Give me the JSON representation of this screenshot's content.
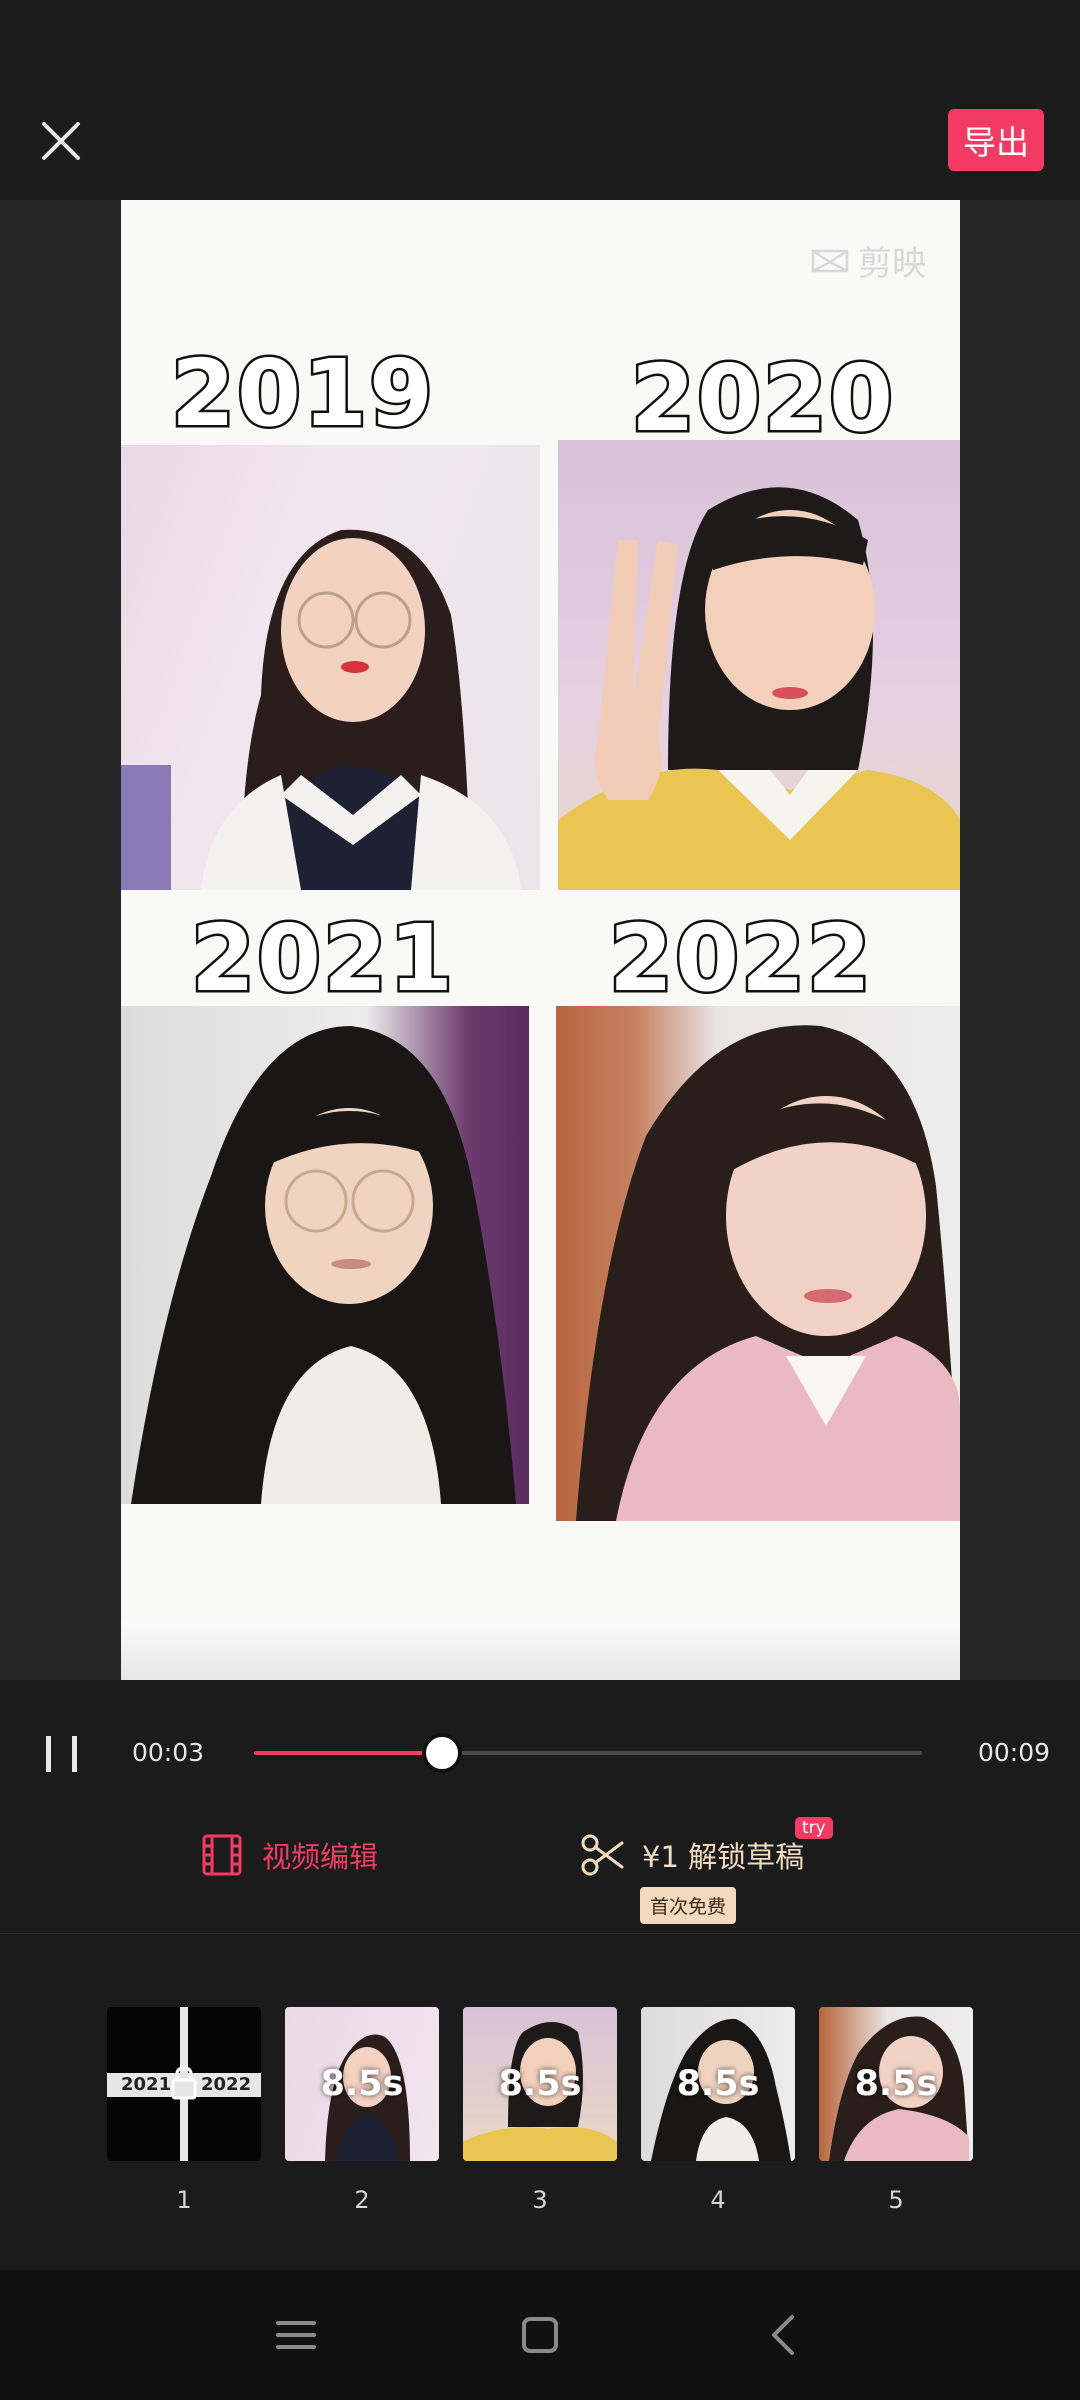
{
  "header": {
    "close_icon": "close-icon",
    "export_label": "导出"
  },
  "preview": {
    "watermark": "剪映",
    "years": [
      "2019",
      "2020",
      "2021",
      "2022"
    ]
  },
  "player": {
    "current_time": "00:03",
    "total_time": "00:09",
    "progress": 0.278,
    "accent": "#f23a62"
  },
  "actions": {
    "edit_label": "视频编辑",
    "unlock_label": "¥1 解锁草稿",
    "try_badge": "try",
    "free_badge": "首次免费"
  },
  "clips": [
    {
      "index": "1",
      "duration": "",
      "thumb": "transition"
    },
    {
      "index": "2",
      "duration": "8.5s",
      "thumb": "photo-2019"
    },
    {
      "index": "3",
      "duration": "8.5s",
      "thumb": "photo-2020"
    },
    {
      "index": "4",
      "duration": "8.5s",
      "thumb": "photo-2021"
    },
    {
      "index": "5",
      "duration": "8.5s",
      "thumb": "photo-2022"
    }
  ],
  "clip1_text": {
    "left": "2021",
    "right": "2022"
  },
  "navbar": {
    "icons": [
      "menu-icon",
      "home-icon",
      "back-icon"
    ]
  }
}
